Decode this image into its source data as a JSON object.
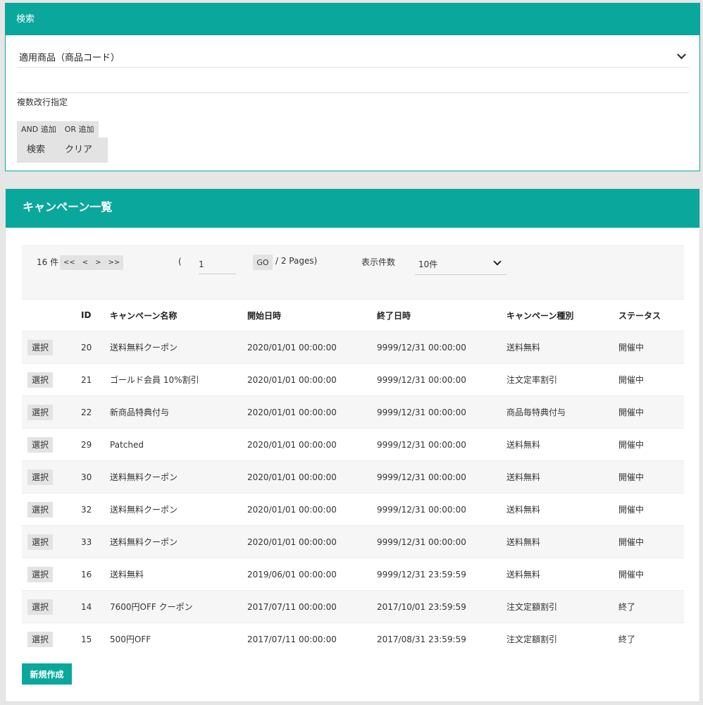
{
  "search": {
    "title": "検索",
    "field_select": "適用商品（商品コード）",
    "text_value": "",
    "multi_label": "複数改行指定",
    "and_label": "AND 追加",
    "or_label": "OR 追加",
    "search_label": "検索",
    "clear_label": "クリア"
  },
  "list": {
    "title": "キャンペーン一覧",
    "pager": {
      "count": "16 件",
      "first": "<<",
      "prev": "<",
      "next": ">",
      "last": ">>",
      "open_paren": "(",
      "current_page": "1",
      "go": "GO",
      "pages": "/ 2 Pages)",
      "per_page_label": "表示件数",
      "per_page": "10件"
    },
    "columns": {
      "id": "ID",
      "name": "キャンペーン名称",
      "start": "開始日時",
      "end": "終了日時",
      "type": "キャンペーン種別",
      "status": "ステータス"
    },
    "select_label": "選択",
    "rows": [
      {
        "id": "20",
        "name": "送料無料クーポン",
        "start": "2020/01/01 00:00:00",
        "end": "9999/12/31 00:00:00",
        "type": "送料無料",
        "status": "開催中"
      },
      {
        "id": "21",
        "name": "ゴールド会員 10%割引",
        "start": "2020/01/01 00:00:00",
        "end": "9999/12/31 00:00:00",
        "type": "注文定率割引",
        "status": "開催中"
      },
      {
        "id": "22",
        "name": "新商品特典付与",
        "start": "2020/01/01 00:00:00",
        "end": "9999/12/31 00:00:00",
        "type": "商品毎特典付与",
        "status": "開催中"
      },
      {
        "id": "29",
        "name": "Patched",
        "start": "2020/01/01 00:00:00",
        "end": "9999/12/31 00:00:00",
        "type": "送料無料",
        "status": "開催中"
      },
      {
        "id": "30",
        "name": "送料無料クーポン",
        "start": "2020/01/01 00:00:00",
        "end": "9999/12/31 00:00:00",
        "type": "送料無料",
        "status": "開催中"
      },
      {
        "id": "32",
        "name": "送料無料クーポン",
        "start": "2020/01/01 00:00:00",
        "end": "9999/12/31 00:00:00",
        "type": "送料無料",
        "status": "開催中"
      },
      {
        "id": "33",
        "name": "送料無料クーポン",
        "start": "2020/01/01 00:00:00",
        "end": "9999/12/31 00:00:00",
        "type": "送料無料",
        "status": "開催中"
      },
      {
        "id": "16",
        "name": "送料無料",
        "start": "2019/06/01 00:00:00",
        "end": "9999/12/31 23:59:59",
        "type": "送料無料",
        "status": "開催中"
      },
      {
        "id": "14",
        "name": "7600円OFF クーポン",
        "start": "2017/07/11 00:00:00",
        "end": "2017/10/01 23:59:59",
        "type": "注文定額割引",
        "status": "終了"
      },
      {
        "id": "15",
        "name": "500円OFF",
        "start": "2017/07/11 00:00:00",
        "end": "2017/08/31 23:59:59",
        "type": "注文定額割引",
        "status": "終了"
      }
    ],
    "new_label": "新規作成"
  }
}
